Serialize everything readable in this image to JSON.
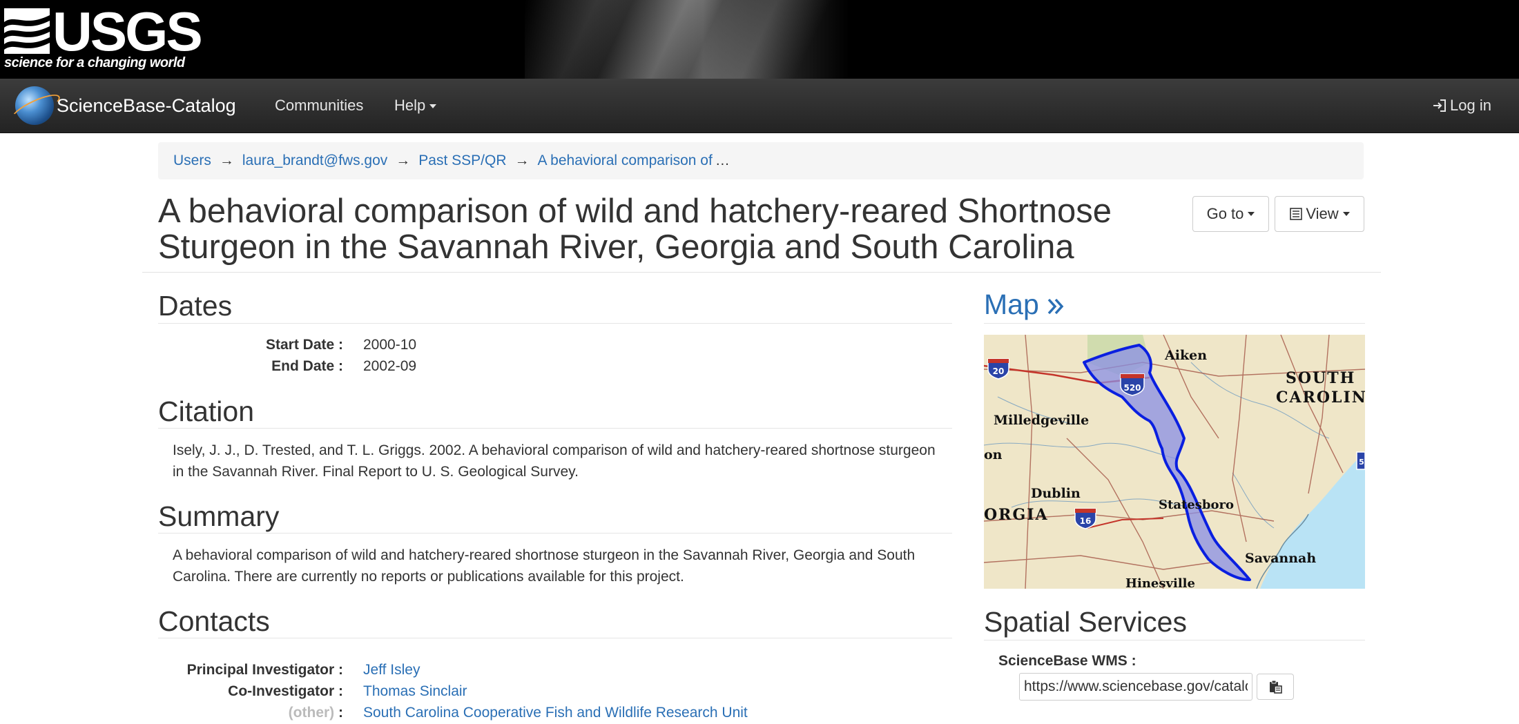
{
  "banner": {
    "logo_text": "USGS",
    "tagline": "science for a changing world"
  },
  "navbar": {
    "brand": "ScienceBase-Catalog",
    "communities": "Communities",
    "help": "Help",
    "login": "Log in"
  },
  "breadcrumb": {
    "items": [
      "Users",
      "laura_brandt@fws.gov",
      "Past SSP/QR",
      "A behavioral comparison of"
    ],
    "separator": "→",
    "ellipsis": "…"
  },
  "page": {
    "title": "A behavioral comparison of wild and hatchery-reared Shortnose Sturgeon in the Savannah River, Georgia and South Carolina",
    "goto_button": "Go to",
    "view_button": "View"
  },
  "dates": {
    "heading": "Dates",
    "rows": [
      {
        "label": "Start Date :",
        "value": "2000-10"
      },
      {
        "label": "End Date :",
        "value": "2002-09"
      }
    ]
  },
  "citation": {
    "heading": "Citation",
    "text": "Isely, J. J., D. Trested, and T. L. Griggs. 2002. A behavioral comparison of wild and hatchery-reared shortnose sturgeon in the Savannah River. Final Report to U. S. Geological Survey."
  },
  "summary": {
    "heading": "Summary",
    "text": "A behavioral comparison of wild and hatchery-reared shortnose sturgeon in the Savannah River, Georgia and South Carolina.  There are currently no reports or publications available for this project."
  },
  "contacts": {
    "heading": "Contacts",
    "rows": [
      {
        "label": "Principal Investigator :",
        "value": "Jeff Isley"
      },
      {
        "label": "Co-Investigator :",
        "value": "Thomas Sinclair"
      },
      {
        "label": "(other)",
        "label_suffix": " :",
        "value": "South Carolina Cooperative Fish and Wildlife Research Unit"
      }
    ]
  },
  "map": {
    "heading": "Map",
    "heading_icon": "double-chevron-right",
    "labels": {
      "aiken": "Aiken",
      "south": "SOUTH",
      "carolina": "CAROLIN",
      "milledgeville": "Milledgeville",
      "on": "on",
      "dublin": "Dublin",
      "orgia": "ORGIA",
      "statesboro": "Statesboro",
      "savannah": "Savannah",
      "hinesville": "Hinesville",
      "i20": "20",
      "i520": "520",
      "i16": "16",
      "i95": "5"
    },
    "colors": {
      "land": "#efe6c8",
      "water": "#b9e3f5",
      "watershed_fill": "#8a8fe6",
      "watershed_stroke": "#0a1fe0",
      "roads": "#9e4a3c"
    }
  },
  "spatial": {
    "heading": "Spatial Services",
    "wms_label": "ScienceBase WMS :",
    "wms_value": "https://www.sciencebase.gov/catalog"
  },
  "colors": {
    "link": "#2a6fb5",
    "navbar": "#2b2b2b",
    "banner": "#000000"
  }
}
